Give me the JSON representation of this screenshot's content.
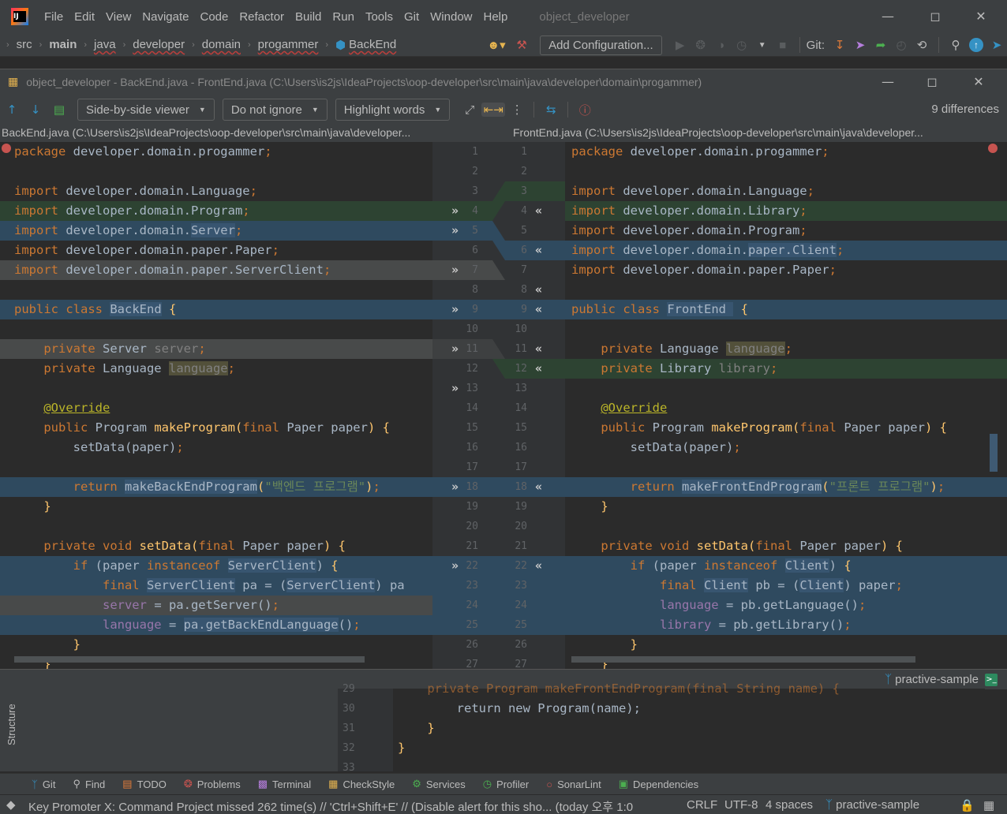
{
  "menubar": {
    "items": [
      "File",
      "Edit",
      "View",
      "Navigate",
      "Code",
      "Refactor",
      "Build",
      "Run",
      "Tools",
      "Git",
      "Window",
      "Help"
    ],
    "project": "object_developer"
  },
  "navbar": {
    "crumbs": [
      "src",
      "main",
      "java",
      "developer",
      "domain",
      "progammer",
      "BackEnd"
    ],
    "add_configuration": "Add Configuration...",
    "git_label": "Git:"
  },
  "diff": {
    "title": "object_developer - BackEnd.java - FrontEnd.java (C:\\Users\\is2js\\IdeaProjects\\oop-developer\\src\\main\\java\\developer\\domain\\progammer)",
    "viewer": "Side-by-side viewer",
    "ignore": "Do not ignore",
    "highlight": "Highlight words",
    "count": "9 differences",
    "left_file": "BackEnd.java (C:\\Users\\is2js\\IdeaProjects\\oop-developer\\src\\main\\java\\developer...",
    "right_file": "FrontEnd.java (C:\\Users\\is2js\\IdeaProjects\\oop-developer\\src\\main\\java\\developer...",
    "branch": "practive-sample"
  },
  "left_lines": [
    "package developer.domain.progammer;",
    "",
    "import developer.domain.Language;",
    "import developer.domain.Program;",
    "import developer.domain.Server;",
    "import developer.domain.paper.Paper;",
    "import developer.domain.paper.ServerClient;",
    "",
    "public class BackEnd {",
    "",
    "    private Server server;",
    "    private Language language;",
    "",
    "    @Override",
    "    public Program makeProgram(final Paper paper) {",
    "        setData(paper);",
    "",
    "        return makeBackEndProgram(\"백엔드 프로그램\");",
    "    }",
    "",
    "    private void setData(final Paper paper) {",
    "        if (paper instanceof ServerClient) {",
    "            final ServerClient pa = (ServerClient) pa",
    "            server = pa.getServer();",
    "            language = pa.getBackEndLanguage();",
    "        }",
    "    }"
  ],
  "right_lines": [
    "package developer.domain.progammer;",
    "",
    "import developer.domain.Language;",
    "import developer.domain.Library;",
    "import developer.domain.Program;",
    "import developer.domain.paper.Client;",
    "import developer.domain.paper.Paper;",
    "",
    "public class FrontEnd  {",
    "",
    "    private Language language;",
    "    private Library library;",
    "",
    "    @Override",
    "    public Program makeProgram(final Paper paper) {",
    "        setData(paper);",
    "",
    "        return makeFrontEndProgram(\"프론트 프로그램\");",
    "    }",
    "",
    "    private void setData(final Paper paper) {",
    "        if (paper instanceof Client) {",
    "            final Client pb = (Client) paper;",
    "            language = pb.getLanguage();",
    "            library = pb.getLibrary();",
    "        }",
    "    }"
  ],
  "left_numbers": [
    "1",
    "2",
    "3",
    "4",
    "5",
    "6",
    "7",
    "8",
    "9",
    "10",
    "11",
    "12",
    "13",
    "14",
    "15",
    "16",
    "17",
    "18",
    "19",
    "20",
    "21",
    "22",
    "23",
    "24",
    "25",
    "26",
    "27"
  ],
  "right_numbers": [
    "1",
    "2",
    "3",
    "4",
    "5",
    "6",
    "7",
    "8",
    "9",
    "10",
    "11",
    "12",
    "13",
    "14",
    "15",
    "16",
    "17",
    "18",
    "19",
    "20",
    "21",
    "22",
    "23",
    "24",
    "25",
    "26",
    "27"
  ],
  "background_editor": {
    "numbers": [
      "29",
      "30",
      "31",
      "32",
      "33"
    ],
    "lines": [
      "    private Program makeFrontEndProgram(final String name) {",
      "        return new Program(name);",
      "    }",
      "}",
      ""
    ]
  },
  "structure_label": "Structure",
  "tool_windows": [
    "Git",
    "Find",
    "TODO",
    "Problems",
    "Terminal",
    "CheckStyle",
    "Services",
    "Profiler",
    "SonarLint",
    "Dependencies"
  ],
  "status": {
    "message": "Key Promoter X: Command Project missed 262 time(s) // 'Ctrl+Shift+E' // (Disable alert for this sho... (today 오후 1:0",
    "line_sep": "CRLF",
    "encoding": "UTF-8",
    "indent": "4 spaces",
    "branch": "practive-sample"
  }
}
